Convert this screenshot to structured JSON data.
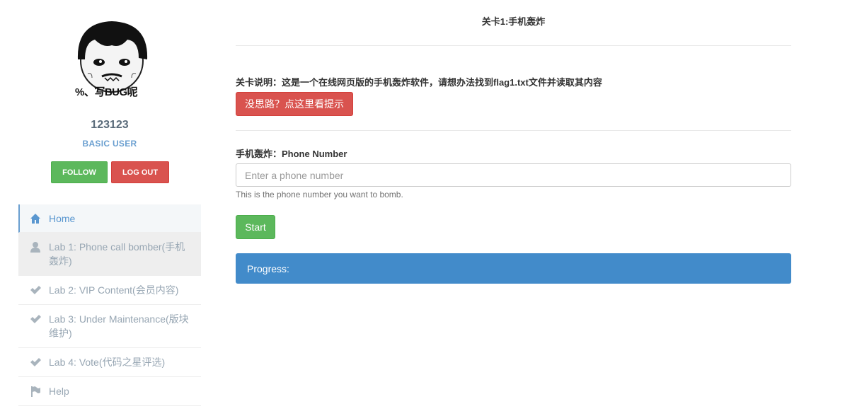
{
  "sidebar": {
    "avatar_caption": "%、写BUG呢",
    "username": "123123",
    "role": "BASIC USER",
    "follow_label": "FOLLOW",
    "logout_label": "LOG OUT",
    "nav": [
      {
        "label": "Home",
        "icon": "home-icon"
      },
      {
        "label": "Lab 1: Phone call bomber(手机轰炸)",
        "icon": "user-icon"
      },
      {
        "label": "Lab 2: VIP Content(会员内容)",
        "icon": "check-icon"
      },
      {
        "label": "Lab 3: Under Maintenance(版块维护)",
        "icon": "check-icon"
      },
      {
        "label": "Lab 4: Vote(代码之星评选)",
        "icon": "check-icon"
      },
      {
        "label": "Help",
        "icon": "flag-icon"
      }
    ]
  },
  "main": {
    "title": "关卡1:手机轰炸",
    "description": "关卡说明：这是一个在线网页版的手机轰炸软件，请想办法找到flag1.txt文件并读取其内容",
    "hint_button": "没思路？点这里看提示",
    "field_label": "手机轰炸：Phone Number",
    "phone_placeholder": "Enter a phone number",
    "help_text": "This is the phone number you want to bomb.",
    "start_button": "Start",
    "progress_label": "Progress:"
  },
  "colors": {
    "success": "#5cb85c",
    "danger": "#d9534f",
    "primary": "#428bca",
    "nav_active": "#5a97d0"
  }
}
